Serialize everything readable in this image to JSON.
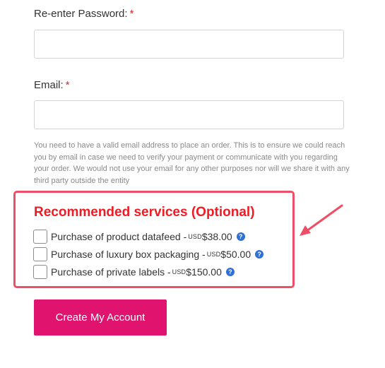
{
  "form": {
    "reenter_password": {
      "label": "Re-enter Password:",
      "required_mark": "*",
      "value": ""
    },
    "email": {
      "label": "Email:",
      "required_mark": "*",
      "value": ""
    },
    "email_help": "You need to have a valid email address to place an order. This is to ensure we could reach you by email in case we need to verify your payment or communicate with you regarding your order. We would not use your email for any other purposes nor will we share it with any third party outside the entity"
  },
  "services": {
    "title": "Recommended services (Optional)",
    "items": [
      {
        "label": "Purchase of product datafeed -",
        "currency": "USD",
        "price": "$38.00",
        "checked": false,
        "help_icon": "question-circle-icon"
      },
      {
        "label": "Purchase of luxury box packaging -",
        "currency": "USD",
        "price": "$50.00",
        "checked": false,
        "help_icon": "question-circle-icon"
      },
      {
        "label": "Purchase of private labels -",
        "currency": "USD",
        "price": "$150.00",
        "checked": false,
        "help_icon": "question-circle-icon"
      }
    ]
  },
  "submit": {
    "label": "Create My Account"
  },
  "colors": {
    "required_mark": "#e2242c",
    "services_title": "#ee1c24",
    "highlight_border": "#ee4e66",
    "help_icon": "#2f6fd6",
    "submit_button": "#e0136f"
  }
}
